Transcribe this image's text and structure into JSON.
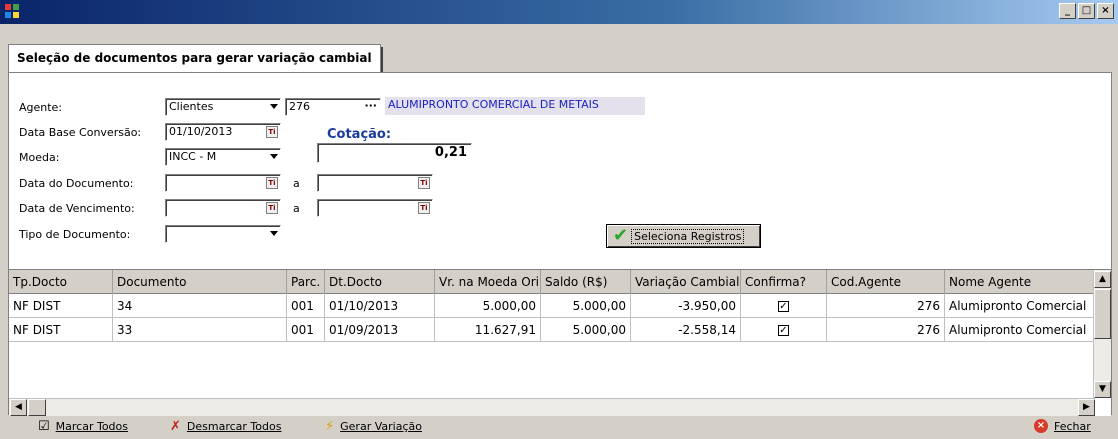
{
  "titlebar": {
    "min_glyph": "_",
    "max_glyph": "□",
    "close_glyph": "×"
  },
  "tab": {
    "label": "Seleção de documentos para gerar variação cambial"
  },
  "form": {
    "agente_label": "Agente:",
    "agente_type": "Clientes",
    "agente_code": "276",
    "agente_name": "ALUMIPRONTO COMERCIAL DE METAIS",
    "data_base_label": "Data Base Conversão:",
    "data_base_value": "01/10/2013",
    "cotacao_label": "Cotação:",
    "cotacao_value": "0,21",
    "moeda_label": "Moeda:",
    "moeda_value": "INCC - M",
    "data_doc_label": "Data do Documento:",
    "data_venc_label": "Data de Vencimento:",
    "range_sep": "a",
    "tipo_doc_label": "Tipo de Documento:",
    "tipo_doc_value": "",
    "select_button": "Seleciona Registros",
    "cal_glyph": "Ti",
    "dots_glyph": "···"
  },
  "grid": {
    "columns": [
      "Tp.Docto",
      "Documento",
      "Parc.",
      "Dt.Docto",
      "Vr. na Moeda Ori",
      "Saldo (R$)",
      "Variação Cambial",
      "Confirma?",
      "Cod.Agente",
      "Nome Agente"
    ],
    "rows": [
      [
        "NF DIST",
        "34",
        "001",
        "01/10/2013",
        "5.000,00",
        "5.000,00",
        "-3.950,00",
        "✓",
        "276",
        "Alumipronto Comercial"
      ],
      [
        "NF DIST",
        "33",
        "001",
        "01/09/2013",
        "11.627,91",
        "5.000,00",
        "-2.558,14",
        "✓",
        "276",
        "Alumipronto Comercial"
      ]
    ]
  },
  "toolbar": {
    "mark_all": "Marcar Todos",
    "unmark_all": "Desmarcar Todos",
    "generate": "Gerar Variação",
    "close": "Fechar"
  },
  "colors": {
    "title_start": "#0a246a",
    "title_end": "#a6caf0",
    "agent_name_text": "#1a22c4",
    "cotacao_label": "#1a3b9c"
  }
}
